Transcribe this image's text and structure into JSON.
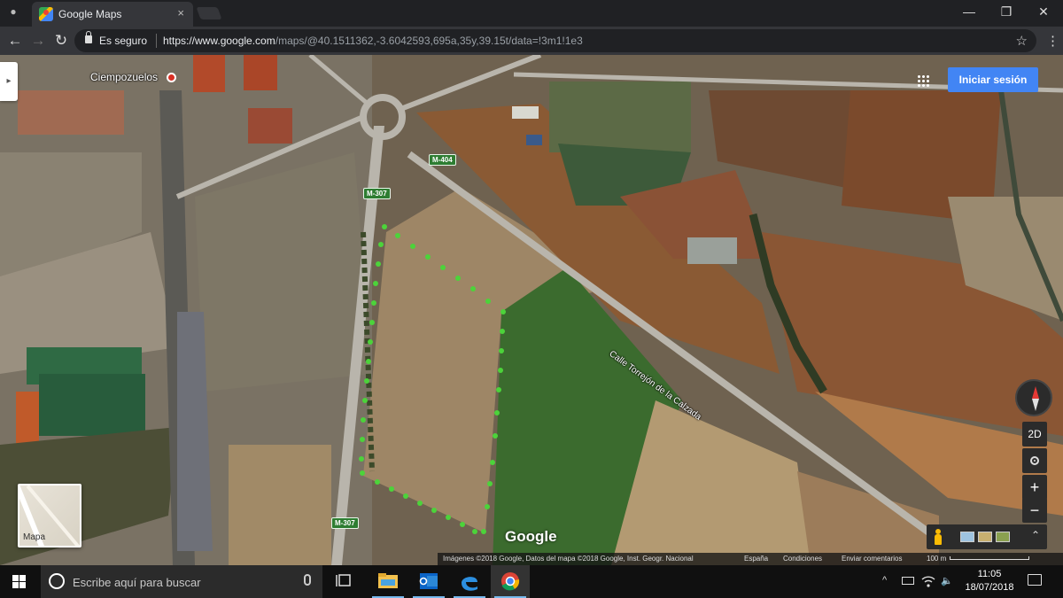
{
  "browser": {
    "tab_title": "Google Maps",
    "tab_close": "×",
    "security_label": "Es seguro",
    "url_host": "https://www.google.com",
    "url_path": "/maps/@40.1511362,-3.6042593,695a,35y,39.15t/data=!3m1!1e3",
    "window_minimize": "—",
    "window_maximize": "❐",
    "window_close": "✕",
    "nav_back": "←",
    "nav_forward": "→",
    "nav_reload": "↻",
    "bookmark_star": "☆",
    "menu_dots": "⋮"
  },
  "map": {
    "expand_arrow": "▸",
    "town_label": "Ciempozuelos",
    "road_labels": [
      "M-404",
      "M-307",
      "M-307"
    ],
    "street_label": "Calle Torrejón de la Calzada",
    "signin_label": "Iniciar sesión",
    "minimap_label": "Mapa",
    "btn_2d": "2D",
    "btn_zoom_in": "+",
    "btn_zoom_out": "−",
    "btn_collapse": "⌃",
    "google_logo": "Google",
    "credits": {
      "imagery": "Imágenes ©2018 Google, Datos del mapa ©2018 Google, Inst. Geogr. Nacional",
      "country": "España",
      "terms": "Condiciones",
      "feedback": "Enviar comentarios",
      "scale": "100 m"
    },
    "colors": {
      "accent_blue": "#4285f4",
      "boundary_dots": "#4cd33a"
    },
    "icons": [
      "apps-grid-icon",
      "compass-icon",
      "pegman-icon",
      "my-location-icon"
    ]
  },
  "taskbar": {
    "search_placeholder": "Escribe aquí para buscar",
    "time": "11:05",
    "date": "18/07/2018",
    "tray_chevron": "^",
    "tray_volume": "🔈",
    "icons": [
      "windows-start-icon",
      "cortana-icon",
      "microphone-icon",
      "task-view-icon",
      "file-explorer-icon",
      "outlook-icon",
      "edge-icon",
      "chrome-icon",
      "notification-icon"
    ]
  }
}
